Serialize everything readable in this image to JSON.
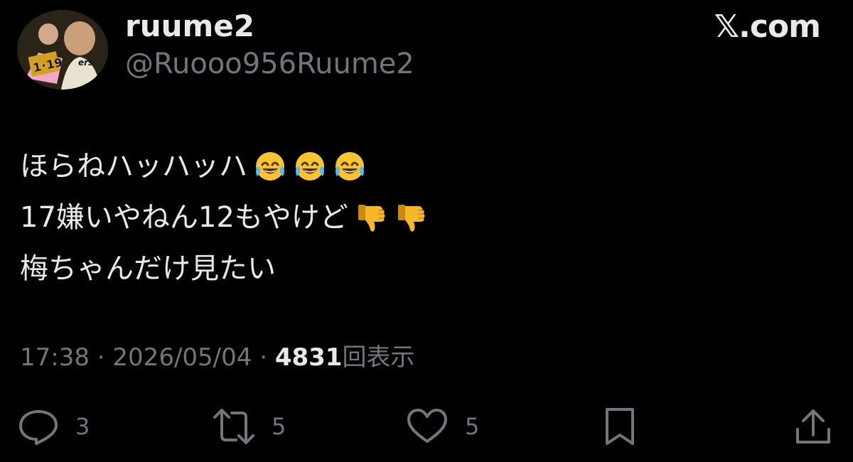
{
  "header": {
    "display_name": "ruume2",
    "handle": "@Ruooo956Ruume2",
    "brand": "𝕏.com"
  },
  "tweet": {
    "lines": [
      {
        "text": "ほらねハッハッハ",
        "emoji": [
          "face-with-tears-of-joy-icon",
          "face-with-tears-of-joy-icon",
          "face-with-tears-of-joy-icon"
        ]
      },
      {
        "text": "17嫌いやねん12もやけど",
        "emoji": [
          "thumbs-down-icon",
          "thumbs-down-icon"
        ]
      },
      {
        "text": "梅ちゃんだけ見たい",
        "emoji": []
      }
    ]
  },
  "meta": {
    "time": "17:38",
    "separator": " · ",
    "date": "2026/05/04",
    "views_count": "4831",
    "views_label": "回表示"
  },
  "actions": {
    "reply_count": "3",
    "repost_count": "5",
    "like_count": "5"
  },
  "colors": {
    "background": "#000000",
    "primary_text": "#e7e9ea",
    "secondary_text": "#71767b"
  }
}
